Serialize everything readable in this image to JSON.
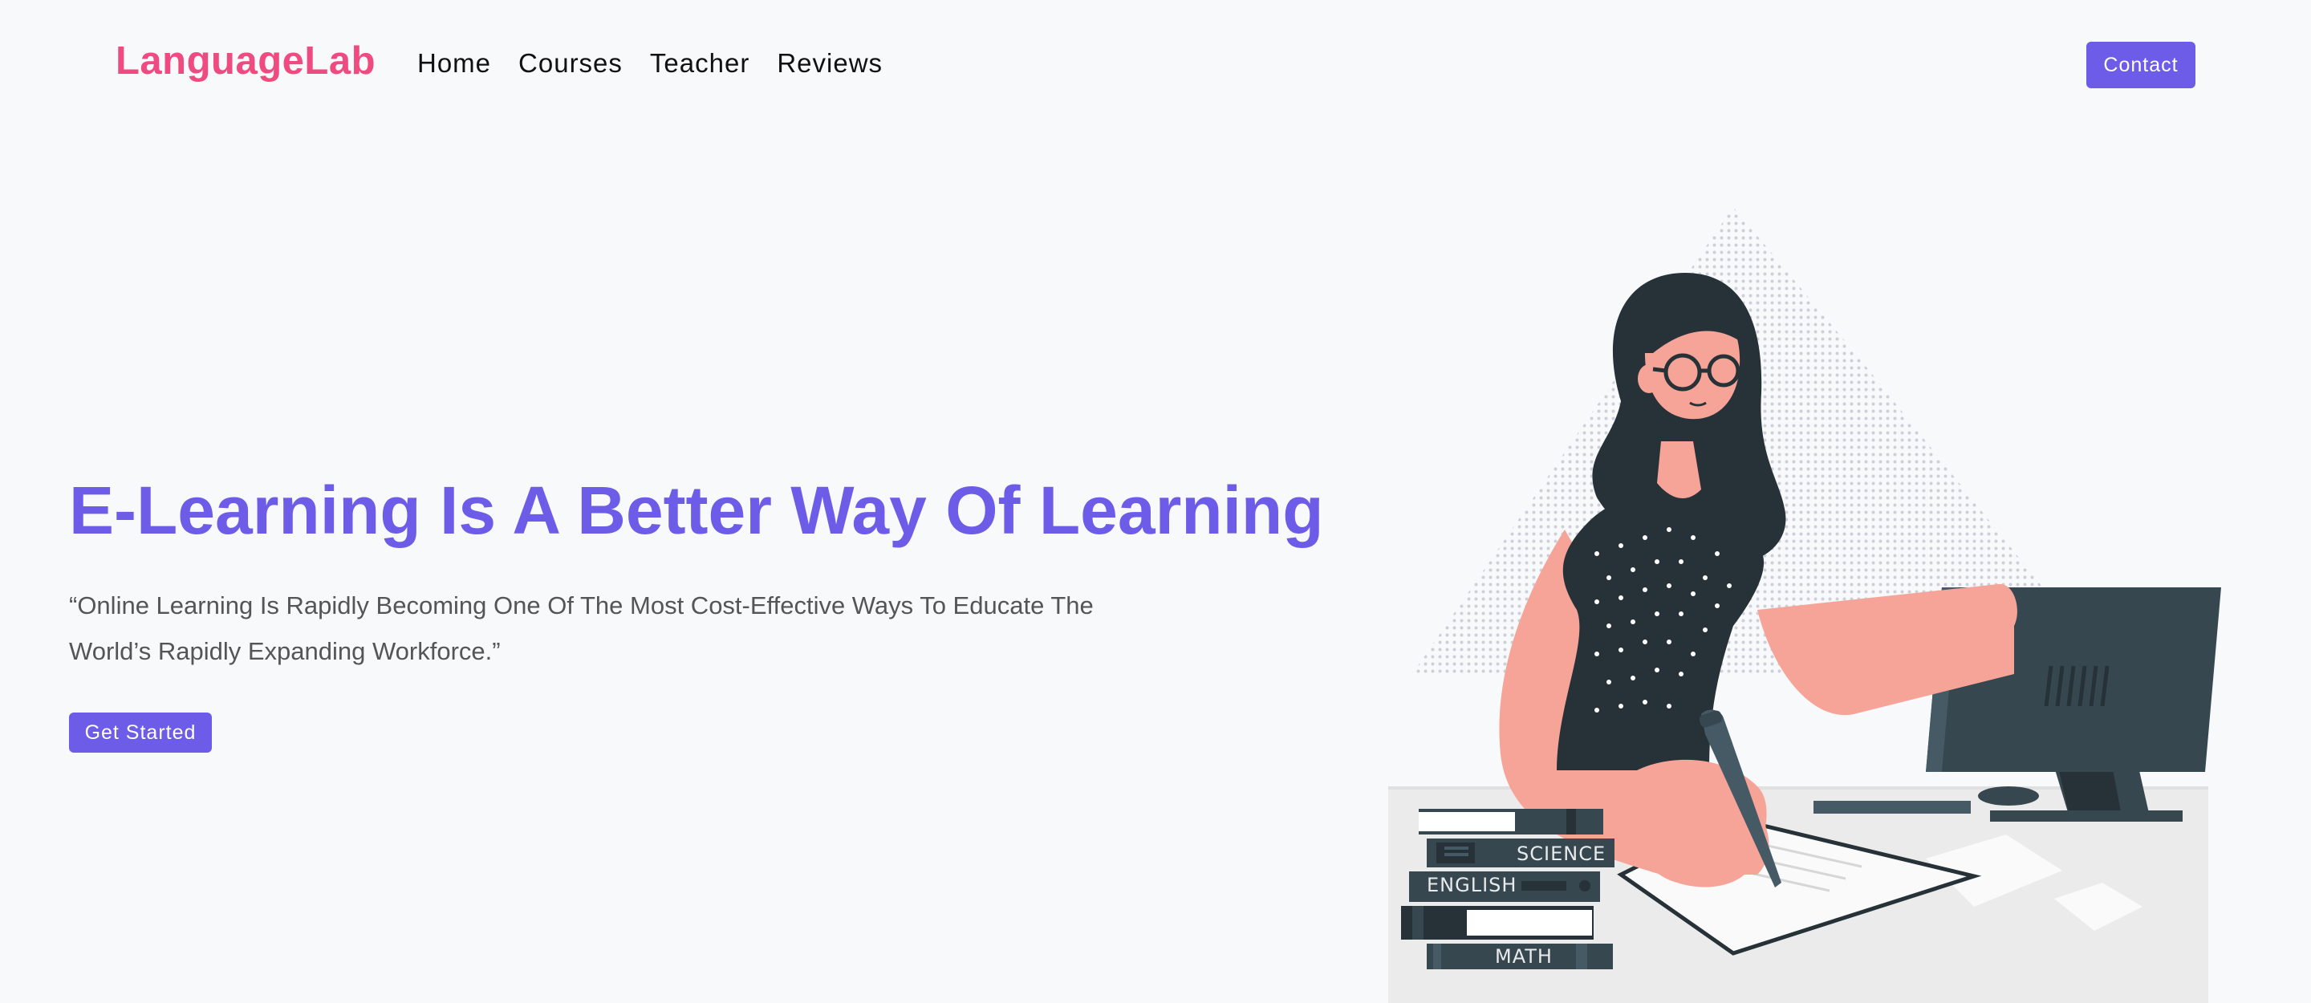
{
  "header": {
    "logo": "LanguageLab",
    "nav": [
      "Home",
      "Courses",
      "Teacher",
      "Reviews"
    ],
    "contact_label": "Contact"
  },
  "hero": {
    "title": "E-Learning Is A Better Way Of Learning",
    "text": "“Online Learning Is Rapidly Becoming One Of The Most Cost-Effective Ways To Educate The World’s Rapidly Expanding Workforce.”",
    "cta_label": "Get Started"
  },
  "illustration": {
    "books": [
      "SCIENCE",
      "ENGLISH",
      "MATH"
    ]
  },
  "colors": {
    "brand_pink": "#ef4b80",
    "accent_purple": "#6c5ce7",
    "background": "#f8f9fb",
    "skin": "#f6a498",
    "dark": "#263238"
  }
}
